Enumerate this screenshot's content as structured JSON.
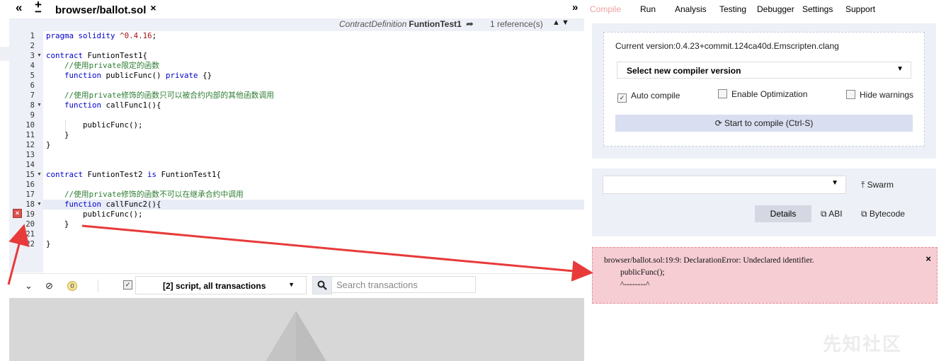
{
  "editor_tabs": {
    "collapse_label": "«",
    "zoom_label": "+",
    "file_name": "browser/ballot.sol",
    "close_label": "×",
    "right_collapse_label": "»"
  },
  "editor_info": {
    "context_label": "ContractDefinition",
    "context_name": "FuntionTest1",
    "references": "1 reference(s)"
  },
  "line_numbers": [
    "1",
    "2",
    "3",
    "4",
    "5",
    "6",
    "7",
    "8",
    "9",
    "10",
    "11",
    "12",
    "13",
    "14",
    "15",
    "16",
    "17",
    "18",
    "19",
    "20",
    "21",
    "22"
  ],
  "code": {
    "l1": "pragma solidity ^0.4.16;",
    "l3": "contract FuntionTest1{",
    "l4": "    //使用private限定的函数",
    "l5": "    function publicFunc() private {}",
    "l7": "    //使用private修饰的函数只可以被合约内部的其他函数调用",
    "l8": "    function callFunc1(){",
    "l10": "        publicFunc();",
    "l11": "    }",
    "l12": "}",
    "l15": "contract FuntionTest2 is FuntionTest1{",
    "l17": "    //使用private修饰的函数不可以在继承合约中调用",
    "l18": "    function callFunc2(){",
    "l19": "        publicFunc();",
    "l20": "    }",
    "l22": "}"
  },
  "terminal": {
    "pending_count": "0",
    "filter_value": "[2] script, all transactions",
    "search_placeholder": "Search transactions"
  },
  "right_tabs": [
    "Compile",
    "Run",
    "Analysis",
    "Testing",
    "Debugger",
    "Settings",
    "Support"
  ],
  "compile": {
    "current_version": "Current version:0.4.23+commit.124ca40d.Emscripten.clang",
    "version_select": "Select new compiler version",
    "auto_compile": "Auto compile",
    "auto_compile_checked": true,
    "enable_optimization": "Enable Optimization",
    "hide_warnings": "Hide warnings",
    "compile_button": "Start to compile (Ctrl-S)"
  },
  "contract": {
    "swarm": "Swarm",
    "details": "Details",
    "abi": "ABI",
    "bytecode": "Bytecode"
  },
  "error": {
    "message": "browser/ballot.sol:19:9: DeclarationError: Undeclared identifier.\n        publicFunc();\n        ^--------^",
    "close": "×"
  },
  "watermark": "先知社区",
  "colors": {
    "active_tab": "#f0a0a0",
    "error_bg": "#f5cdd3",
    "arrow": "#e83a3a",
    "editor_gutter_bg": "#eef0f7"
  }
}
